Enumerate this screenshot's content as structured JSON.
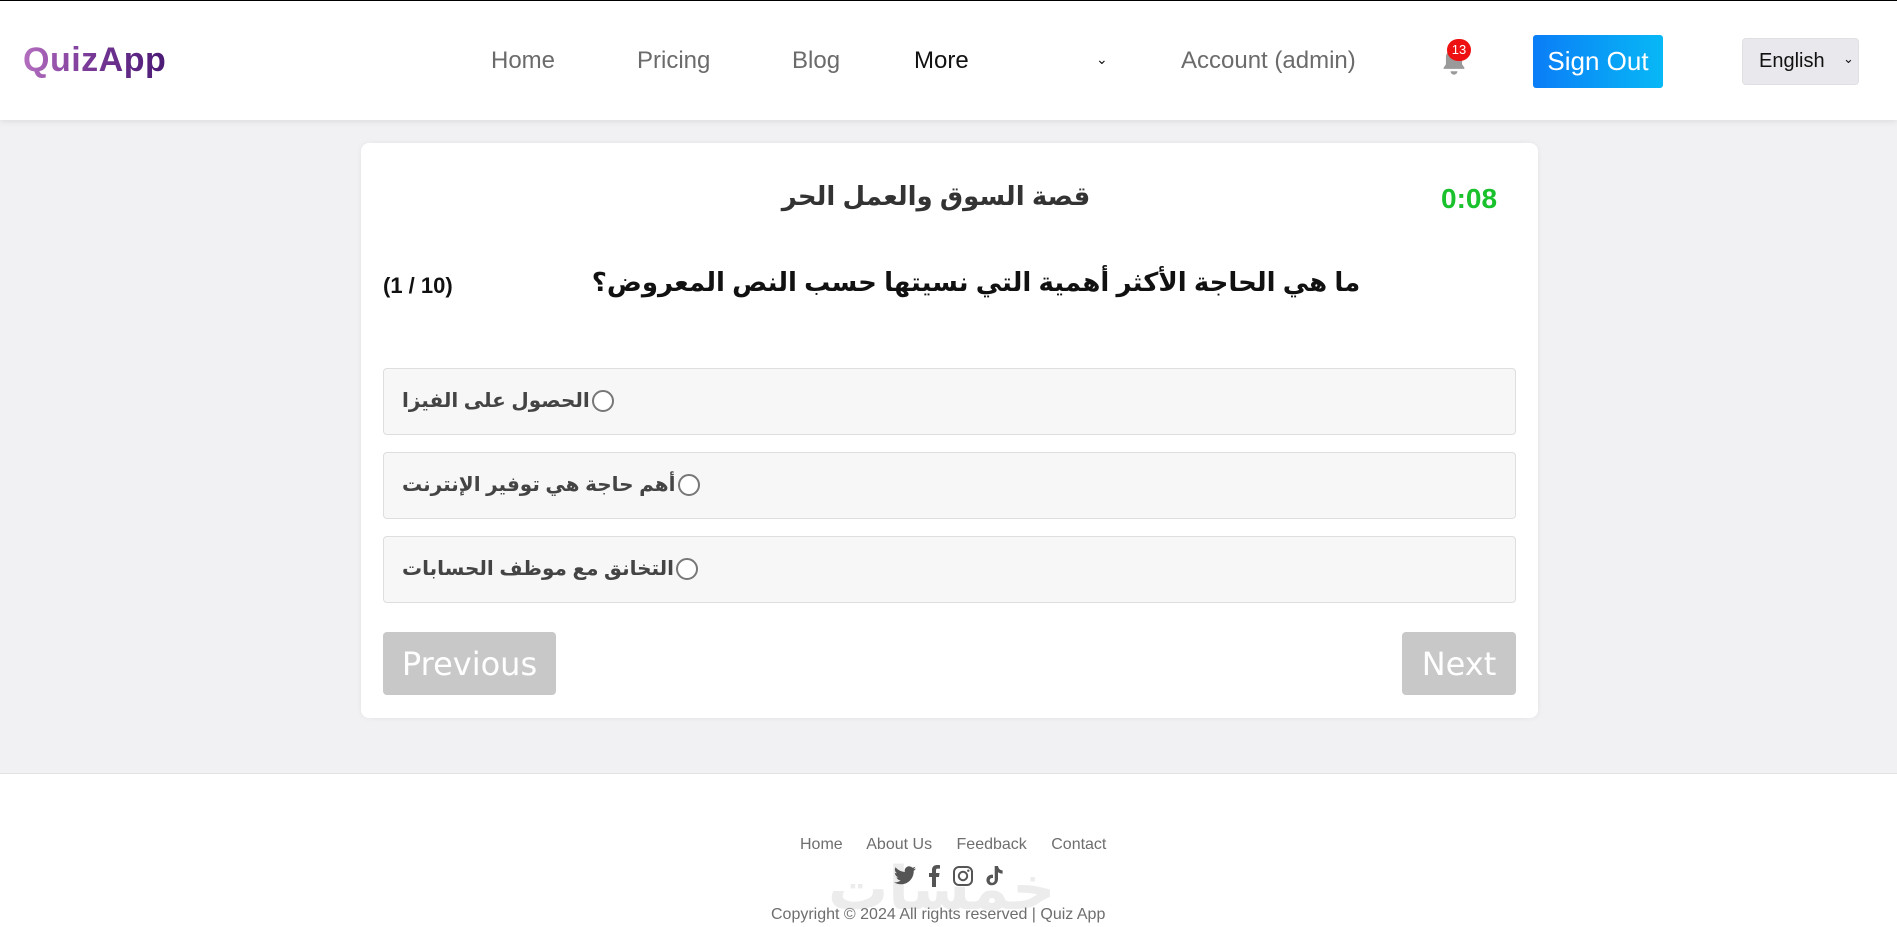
{
  "header": {
    "logo": "QuizApp",
    "nav": {
      "home": "Home",
      "pricing": "Pricing",
      "blog": "Blog",
      "more": "More",
      "account": "Account (admin)"
    },
    "notifications_count": "13",
    "sign_out": "Sign Out",
    "language": "English"
  },
  "quiz": {
    "title": "قصة السوق والعمل الحر",
    "timer": "0:08",
    "question": "ما هي الحاجة الأكثر أهمية التي نسيتها حسب النص المعروض؟",
    "counter": "(1 / 10)",
    "options": [
      {
        "label": "الحصول على الفيزا"
      },
      {
        "label": "أهم حاجة هي توفير الإنترنت"
      },
      {
        "label": "التخانق مع موظف الحسابات"
      }
    ],
    "previous": "Previous",
    "next": "Next"
  },
  "footer": {
    "links": [
      "Home",
      "About Us",
      "Feedback",
      "Contact"
    ],
    "social": [
      "twitter-icon",
      "facebook-icon",
      "instagram-icon",
      "tiktok-icon"
    ],
    "copyright": "Copyright © 2024 All rights reserved | Quiz App",
    "watermark": "خمسات"
  },
  "colors": {
    "accent_blue": "#0a7df7",
    "timer_green": "#19c12c",
    "badge_red": "#ee1111",
    "disabled_button": "#c8c8c8"
  }
}
